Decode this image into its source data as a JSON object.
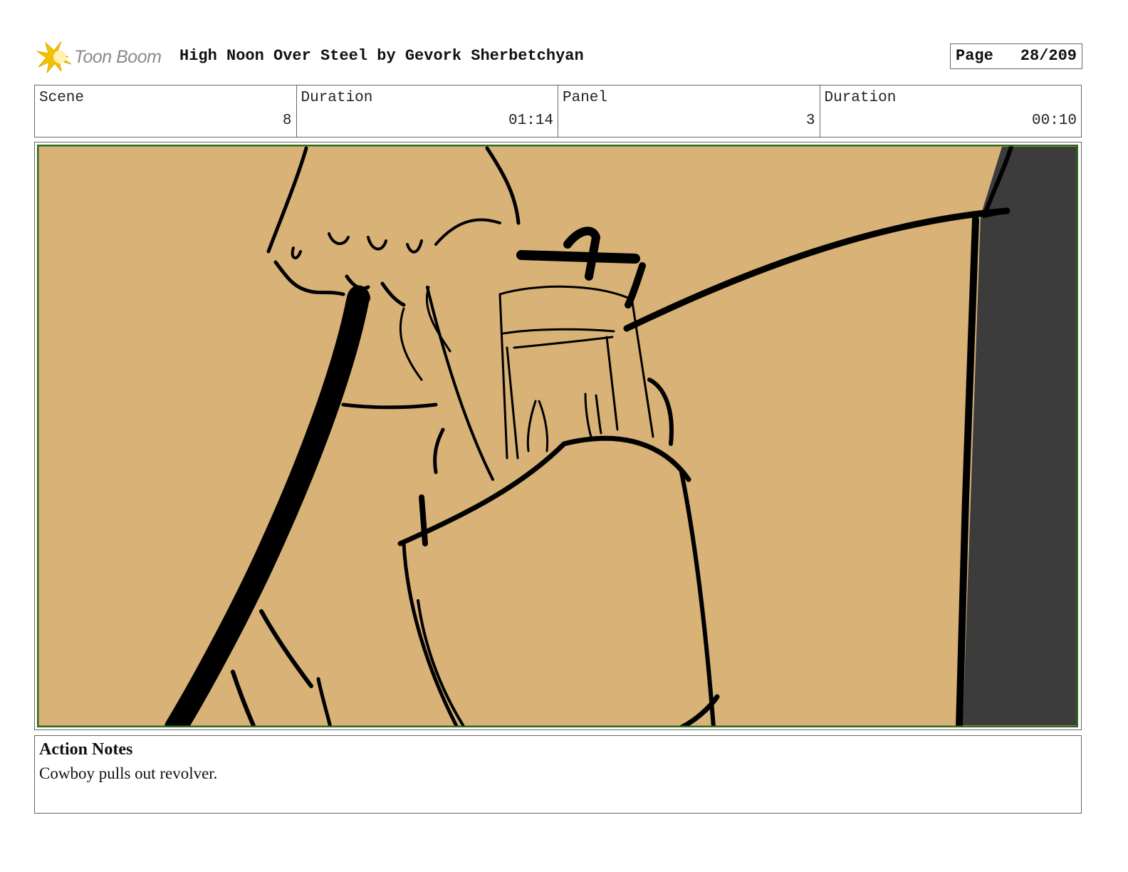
{
  "header": {
    "logo_text": "Toon Boom",
    "title": "High Noon Over Steel by Gevork Sherbetchyan",
    "page_label": "Page",
    "page_value": "28/209"
  },
  "info": {
    "scene_label": "Scene",
    "scene_value": "8",
    "scene_duration_label": "Duration",
    "scene_duration_value": "01:14",
    "panel_label": "Panel",
    "panel_value": "3",
    "panel_duration_label": "Duration",
    "panel_duration_value": "00:10"
  },
  "colors": {
    "panel_background": "#d8b276",
    "panel_border": "#2e6b1f",
    "shadow_wall": "#3c3c3c",
    "logo_star": "#f2c200"
  },
  "notes": {
    "title": "Action Notes",
    "text": "Cowboy pulls out revolver."
  }
}
